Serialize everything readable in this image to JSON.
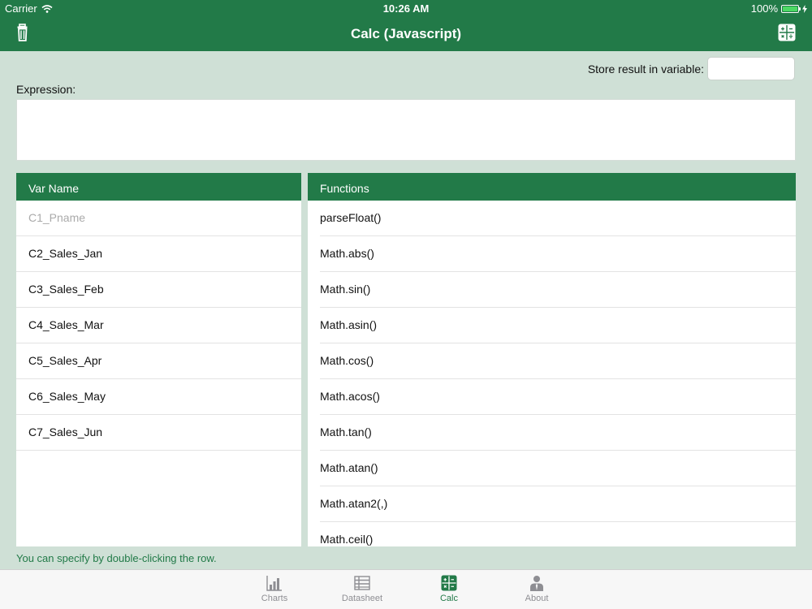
{
  "status": {
    "carrier": "Carrier",
    "time": "10:26 AM",
    "battery": "100%"
  },
  "nav": {
    "title": "Calc (Javascript)"
  },
  "store": {
    "label": "Store result in variable:",
    "value": ""
  },
  "expression": {
    "label": "Expression:",
    "value": ""
  },
  "vars": {
    "header": "Var Name",
    "items": [
      "C1_Pname",
      "C2_Sales_Jan",
      "C3_Sales_Feb",
      "C4_Sales_Mar",
      "C5_Sales_Apr",
      "C6_Sales_May",
      "C7_Sales_Jun"
    ]
  },
  "functions": {
    "header": "Functions",
    "items": [
      "parseFloat()",
      "Math.abs()",
      "Math.sin()",
      "Math.asin()",
      "Math.cos()",
      "Math.acos()",
      "Math.tan()",
      "Math.atan()",
      "Math.atan2(,)",
      "Math.ceil()"
    ]
  },
  "hint": "You can specify by double-clicking the row.",
  "tabs": {
    "charts": "Charts",
    "datasheet": "Datasheet",
    "calc": "Calc",
    "about": "About"
  },
  "colors": {
    "brand": "#227a48",
    "background": "#cfe0d6",
    "inactive_tab": "#8e8e93"
  }
}
